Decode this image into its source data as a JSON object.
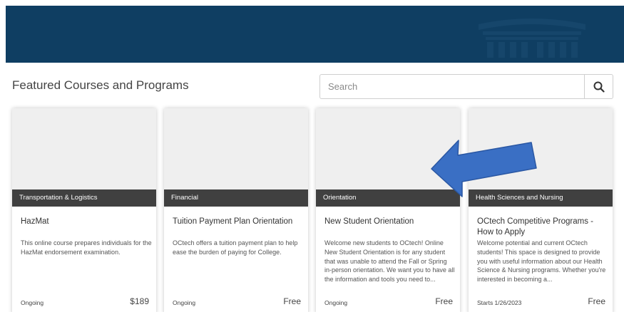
{
  "header": {
    "section_title": "Featured Courses and Programs"
  },
  "search": {
    "placeholder": "Search",
    "icon": "search-icon"
  },
  "cards": [
    {
      "category": "Transportation & Logistics",
      "title": "HazMat",
      "description": "This online course prepares individuals for the HazMat endorsement examination.",
      "status": "Ongoing",
      "price": "$189"
    },
    {
      "category": "Financial",
      "title": "Tuition Payment Plan Orientation",
      "description": "OCtech offers a tuition payment plan to help ease the burden of paying for College.",
      "status": "Ongoing",
      "price": "Free"
    },
    {
      "category": "Orientation",
      "title": "New Student Orientation",
      "description": "Welcome new students to OCtech! Online New Student Orientation is for any student that was unable to attend the Fall or Spring in-person orientation. We want you to have all the information and tools you need to...",
      "status": "Ongoing",
      "price": "Free"
    },
    {
      "category": "Health Sciences and Nursing",
      "title": "OCtech Competitive Programs - How to Apply",
      "description": "Welcome potential and current OCtech students! This space is designed to provide you with useful information about our Health Science & Nursing programs. Whether you're interested in becoming a...",
      "status": "Starts 1/26/2023",
      "price": "Free"
    }
  ],
  "colors": {
    "banner": "#0f3e62",
    "category_bar": "#404040",
    "annotation_arrow": "#3a6fc4"
  }
}
